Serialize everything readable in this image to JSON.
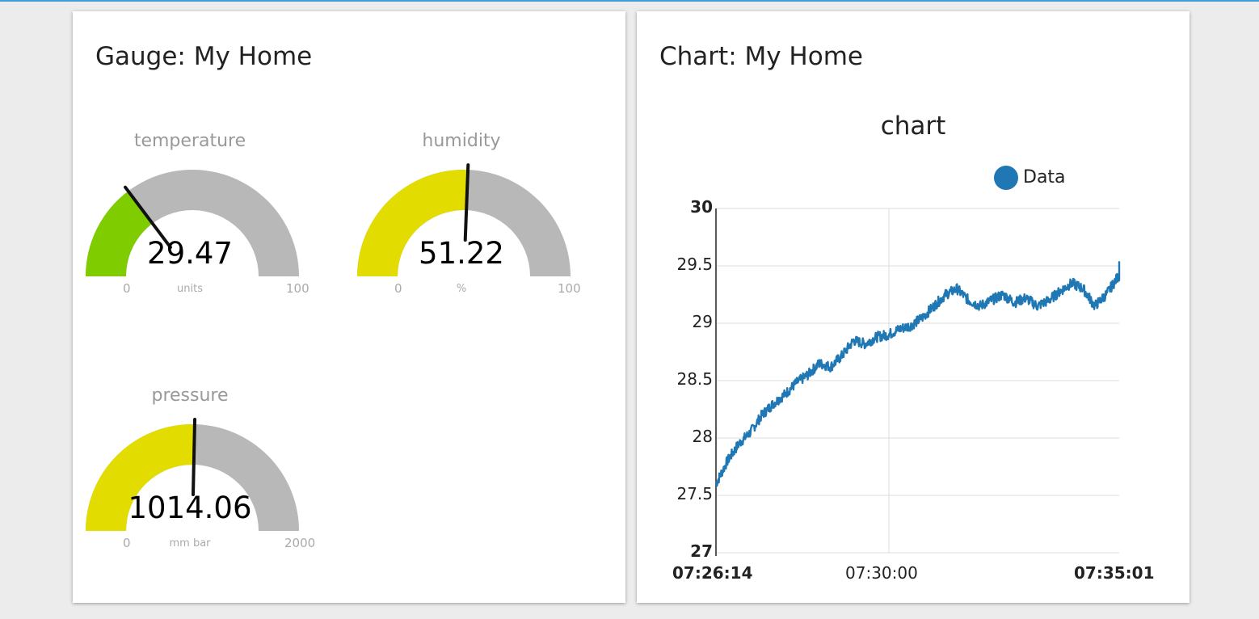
{
  "gauge_card": {
    "title": "Gauge: My Home",
    "gauges": [
      {
        "label": "temperature",
        "value_text": "29.47",
        "value": 29.47,
        "min": 0,
        "max": 100,
        "min_label": "0",
        "max_label": "100",
        "units": "units",
        "color": "#7fcc00"
      },
      {
        "label": "humidity",
        "value_text": "51.22",
        "value": 51.22,
        "min": 0,
        "max": 100,
        "min_label": "0",
        "max_label": "100",
        "units": "%",
        "color": "#e2dc00"
      },
      {
        "label": "pressure",
        "value_text": "1014.06",
        "value": 1014.06,
        "min": 0,
        "max": 2000,
        "min_label": "0",
        "max_label": "2000",
        "units": "mm bar",
        "color": "#e2dc00"
      }
    ],
    "track_color": "#b8b8b8"
  },
  "chart_card": {
    "title": "Chart: My Home"
  },
  "chart_data": {
    "type": "line",
    "title": "chart",
    "legend_placement": "top-right",
    "grid": true,
    "series": [
      {
        "name": "Data",
        "color": "#1f77b4",
        "x_seconds_from_start": [
          0,
          15,
          30,
          45,
          60,
          75,
          90,
          105,
          120,
          135,
          150,
          165,
          180,
          195,
          210,
          225,
          240,
          255,
          270,
          285,
          300,
          315,
          330,
          345,
          360,
          375,
          390,
          405,
          420,
          435,
          450,
          465,
          480,
          495,
          510,
          525,
          540,
          555,
          567
        ],
        "values": [
          27.6,
          27.8,
          27.95,
          28.05,
          28.2,
          28.3,
          28.38,
          28.48,
          28.55,
          28.65,
          28.62,
          28.72,
          28.85,
          28.82,
          28.88,
          28.9,
          28.95,
          28.98,
          29.05,
          29.15,
          29.25,
          29.3,
          29.2,
          29.15,
          29.2,
          29.25,
          29.18,
          29.22,
          29.15,
          29.2,
          29.28,
          29.35,
          29.3,
          29.15,
          29.25,
          29.4,
          29.5,
          29.45,
          29.45
        ]
      }
    ],
    "ylim": [
      27,
      30
    ],
    "y_ticks": [
      "30",
      "29.5",
      "29",
      "28.5",
      "28",
      "27.5",
      "27"
    ],
    "x_ticks": [
      "07:26:14",
      "07:30:00",
      "07:35:01"
    ],
    "x_tick_seconds": [
      0,
      226,
      527
    ],
    "xlabel": "",
    "ylabel": ""
  }
}
